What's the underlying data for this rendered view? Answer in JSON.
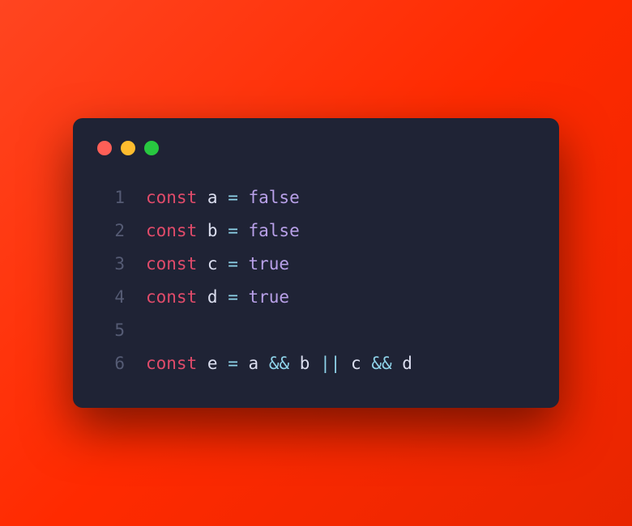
{
  "window": {
    "controls": [
      "close",
      "minimize",
      "maximize"
    ]
  },
  "code": {
    "lines": [
      {
        "number": "1",
        "tokens": [
          {
            "type": "keyword",
            "text": "const"
          },
          {
            "type": "space",
            "text": " "
          },
          {
            "type": "identifier",
            "text": "a"
          },
          {
            "type": "space",
            "text": " "
          },
          {
            "type": "operator",
            "text": "="
          },
          {
            "type": "space",
            "text": " "
          },
          {
            "type": "boolean",
            "text": "false"
          }
        ]
      },
      {
        "number": "2",
        "tokens": [
          {
            "type": "keyword",
            "text": "const"
          },
          {
            "type": "space",
            "text": " "
          },
          {
            "type": "identifier",
            "text": "b"
          },
          {
            "type": "space",
            "text": " "
          },
          {
            "type": "operator",
            "text": "="
          },
          {
            "type": "space",
            "text": " "
          },
          {
            "type": "boolean",
            "text": "false"
          }
        ]
      },
      {
        "number": "3",
        "tokens": [
          {
            "type": "keyword",
            "text": "const"
          },
          {
            "type": "space",
            "text": " "
          },
          {
            "type": "identifier",
            "text": "c"
          },
          {
            "type": "space",
            "text": " "
          },
          {
            "type": "operator",
            "text": "="
          },
          {
            "type": "space",
            "text": " "
          },
          {
            "type": "boolean",
            "text": "true"
          }
        ]
      },
      {
        "number": "4",
        "tokens": [
          {
            "type": "keyword",
            "text": "const"
          },
          {
            "type": "space",
            "text": " "
          },
          {
            "type": "identifier",
            "text": "d"
          },
          {
            "type": "space",
            "text": " "
          },
          {
            "type": "operator",
            "text": "="
          },
          {
            "type": "space",
            "text": " "
          },
          {
            "type": "boolean",
            "text": "true"
          }
        ]
      },
      {
        "number": "5",
        "tokens": []
      },
      {
        "number": "6",
        "tokens": [
          {
            "type": "keyword",
            "text": "const"
          },
          {
            "type": "space",
            "text": " "
          },
          {
            "type": "identifier",
            "text": "e"
          },
          {
            "type": "space",
            "text": " "
          },
          {
            "type": "operator",
            "text": "="
          },
          {
            "type": "space",
            "text": " "
          },
          {
            "type": "identifier",
            "text": "a"
          },
          {
            "type": "space",
            "text": " "
          },
          {
            "type": "operator",
            "text": "&&"
          },
          {
            "type": "space",
            "text": " "
          },
          {
            "type": "identifier",
            "text": "b"
          },
          {
            "type": "space",
            "text": " "
          },
          {
            "type": "operator",
            "text": "||"
          },
          {
            "type": "space",
            "text": " "
          },
          {
            "type": "identifier",
            "text": "c"
          },
          {
            "type": "space",
            "text": " "
          },
          {
            "type": "operator",
            "text": "&&"
          },
          {
            "type": "space",
            "text": " "
          },
          {
            "type": "identifier",
            "text": "d"
          }
        ]
      }
    ]
  }
}
